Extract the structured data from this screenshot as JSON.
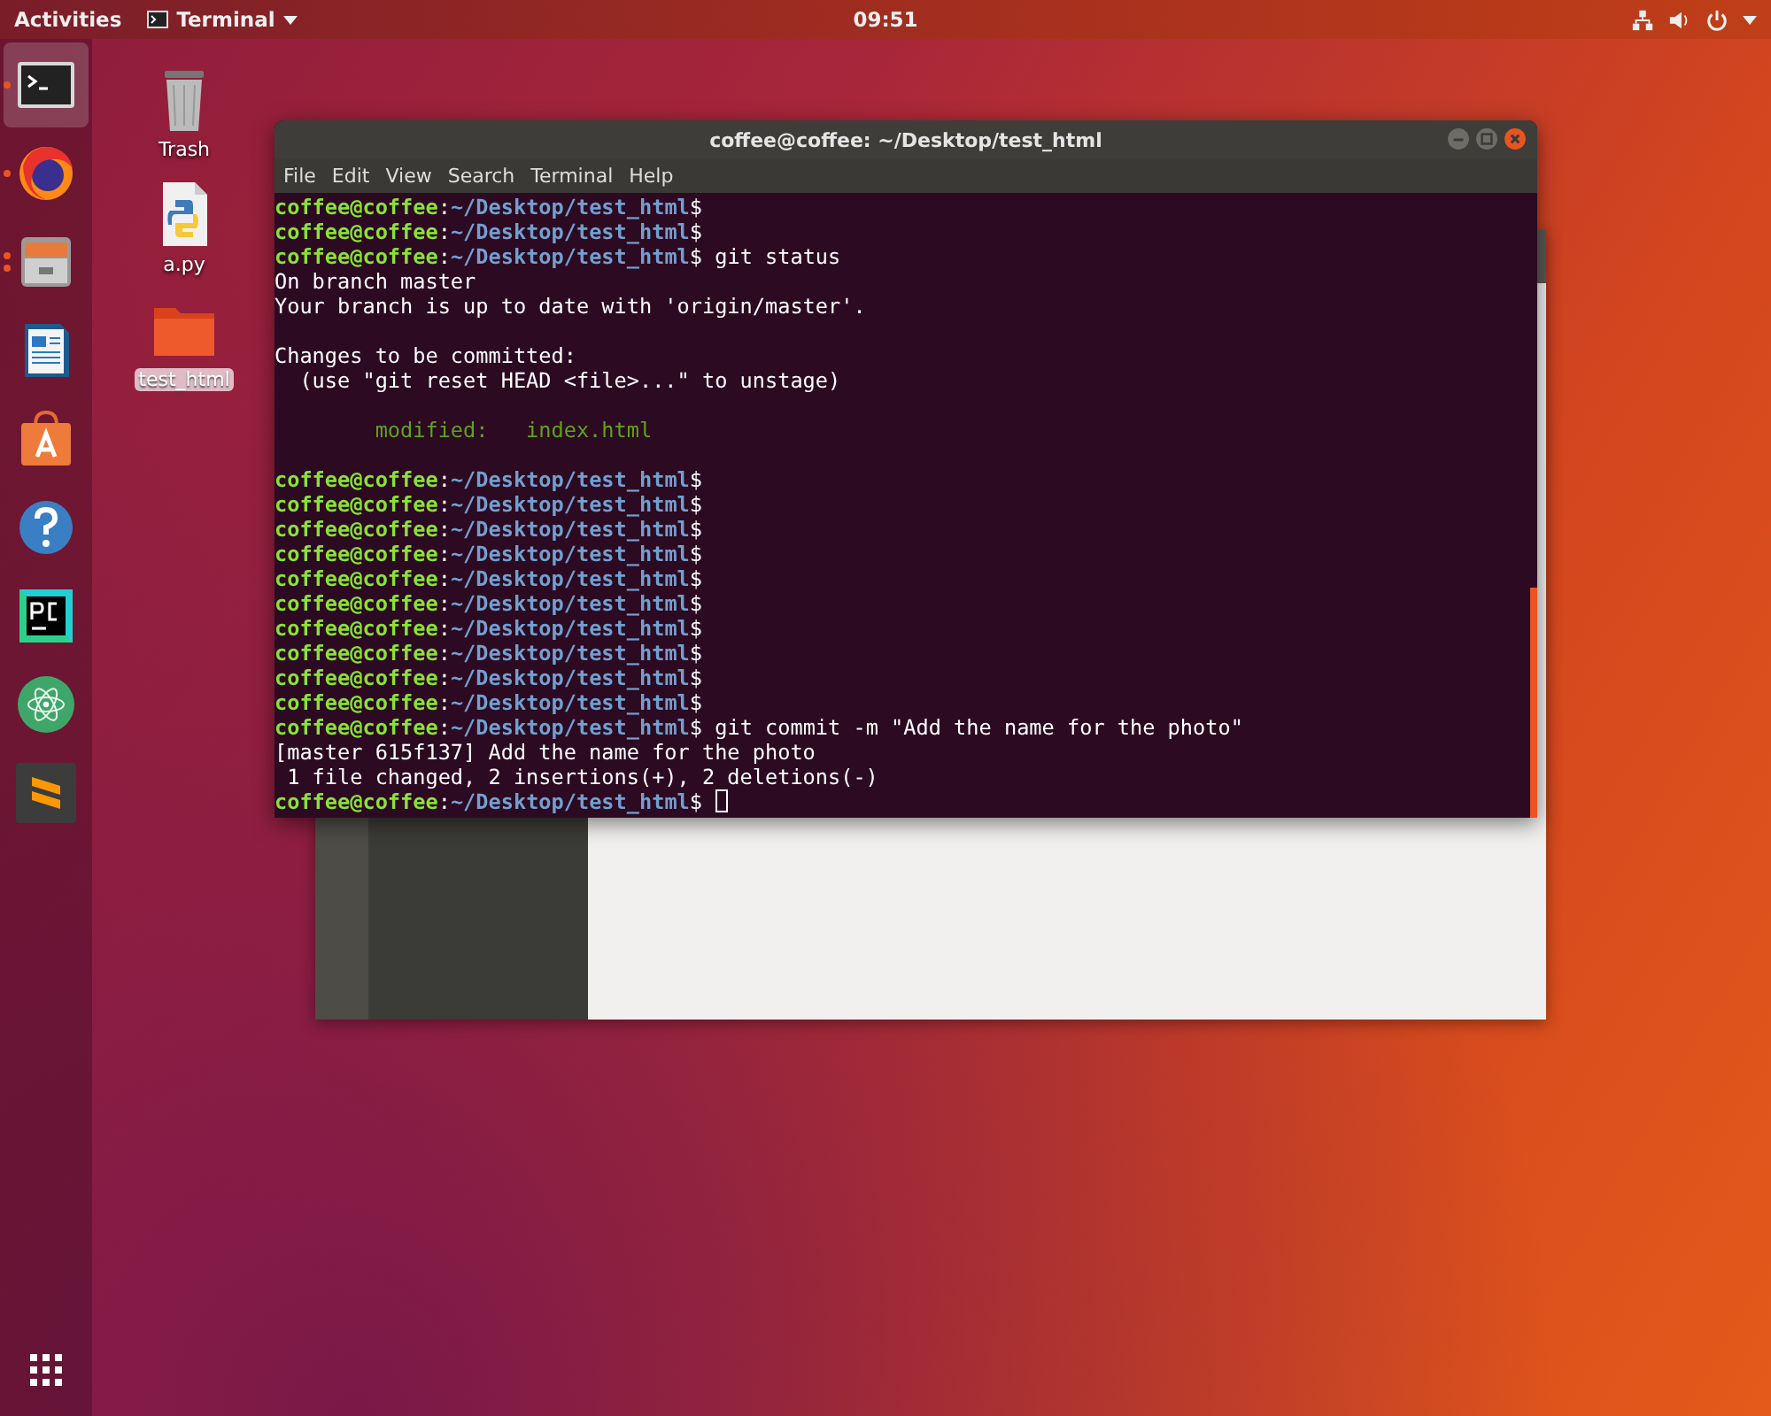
{
  "top_bar": {
    "activities": "Activities",
    "app_menu": "Terminal",
    "clock": "09:51"
  },
  "dock": [
    {
      "kind": "terminal",
      "selected": true,
      "running": true
    },
    {
      "kind": "firefox",
      "selected": false,
      "running": true
    },
    {
      "kind": "files",
      "selected": false,
      "running": true,
      "multiple_windows": true
    },
    {
      "kind": "writer",
      "selected": false,
      "running": false
    },
    {
      "kind": "store",
      "selected": false,
      "running": false
    },
    {
      "kind": "help",
      "selected": false,
      "running": false
    },
    {
      "kind": "pycharm",
      "selected": false,
      "running": false
    },
    {
      "kind": "atom",
      "selected": false,
      "running": false
    },
    {
      "kind": "sublime",
      "selected": false,
      "running": false
    }
  ],
  "desktop_icons": [
    {
      "kind": "trash",
      "label": "Trash",
      "selected": false
    },
    {
      "kind": "python",
      "label": "a.py",
      "selected": false
    },
    {
      "kind": "folder",
      "label": "test_html",
      "selected": true
    }
  ],
  "terminal": {
    "title": "coffee@coffee: ~/Desktop/test_html",
    "menu": [
      "File",
      "Edit",
      "View",
      "Search",
      "Terminal",
      "Help"
    ],
    "lines": [
      {
        "kind": "prompt",
        "user": "coffee@coffee",
        "sep": ":",
        "path": "~/Desktop/test_html",
        "end": "$"
      },
      {
        "kind": "prompt",
        "user": "coffee@coffee",
        "sep": ":",
        "path": "~/Desktop/test_html",
        "end": "$"
      },
      {
        "kind": "prompt",
        "user": "coffee@coffee",
        "sep": ":",
        "path": "~/Desktop/test_html",
        "end": "$",
        "command": " git status"
      },
      {
        "kind": "output",
        "text": "On branch master"
      },
      {
        "kind": "output",
        "text": "Your branch is up to date with 'origin/master'."
      },
      {
        "kind": "blank"
      },
      {
        "kind": "output",
        "text": "Changes to be committed:"
      },
      {
        "kind": "output",
        "text": "  (use \"git reset HEAD <file>...\" to unstage)"
      },
      {
        "kind": "blank"
      },
      {
        "kind": "staged",
        "text": "        modified:   index.html"
      },
      {
        "kind": "blank"
      },
      {
        "kind": "prompt",
        "user": "coffee@coffee",
        "sep": ":",
        "path": "~/Desktop/test_html",
        "end": "$"
      },
      {
        "kind": "prompt",
        "user": "coffee@coffee",
        "sep": ":",
        "path": "~/Desktop/test_html",
        "end": "$"
      },
      {
        "kind": "prompt",
        "user": "coffee@coffee",
        "sep": ":",
        "path": "~/Desktop/test_html",
        "end": "$"
      },
      {
        "kind": "prompt",
        "user": "coffee@coffee",
        "sep": ":",
        "path": "~/Desktop/test_html",
        "end": "$"
      },
      {
        "kind": "prompt",
        "user": "coffee@coffee",
        "sep": ":",
        "path": "~/Desktop/test_html",
        "end": "$"
      },
      {
        "kind": "prompt",
        "user": "coffee@coffee",
        "sep": ":",
        "path": "~/Desktop/test_html",
        "end": "$"
      },
      {
        "kind": "prompt",
        "user": "coffee@coffee",
        "sep": ":",
        "path": "~/Desktop/test_html",
        "end": "$"
      },
      {
        "kind": "prompt",
        "user": "coffee@coffee",
        "sep": ":",
        "path": "~/Desktop/test_html",
        "end": "$"
      },
      {
        "kind": "prompt",
        "user": "coffee@coffee",
        "sep": ":",
        "path": "~/Desktop/test_html",
        "end": "$"
      },
      {
        "kind": "prompt",
        "user": "coffee@coffee",
        "sep": ":",
        "path": "~/Desktop/test_html",
        "end": "$"
      },
      {
        "kind": "prompt",
        "user": "coffee@coffee",
        "sep": ":",
        "path": "~/Desktop/test_html",
        "end": "$",
        "command": " git commit -m \"Add the name for the photo\""
      },
      {
        "kind": "output",
        "text": "[master 615f137] Add the name for the photo"
      },
      {
        "kind": "output",
        "text": " 1 file changed, 2 insertions(+), 2 deletions(-)"
      },
      {
        "kind": "prompt",
        "user": "coffee@coffee",
        "sep": ":",
        "path": "~/Desktop/test_html",
        "end": "$",
        "cursor": true
      }
    ]
  }
}
